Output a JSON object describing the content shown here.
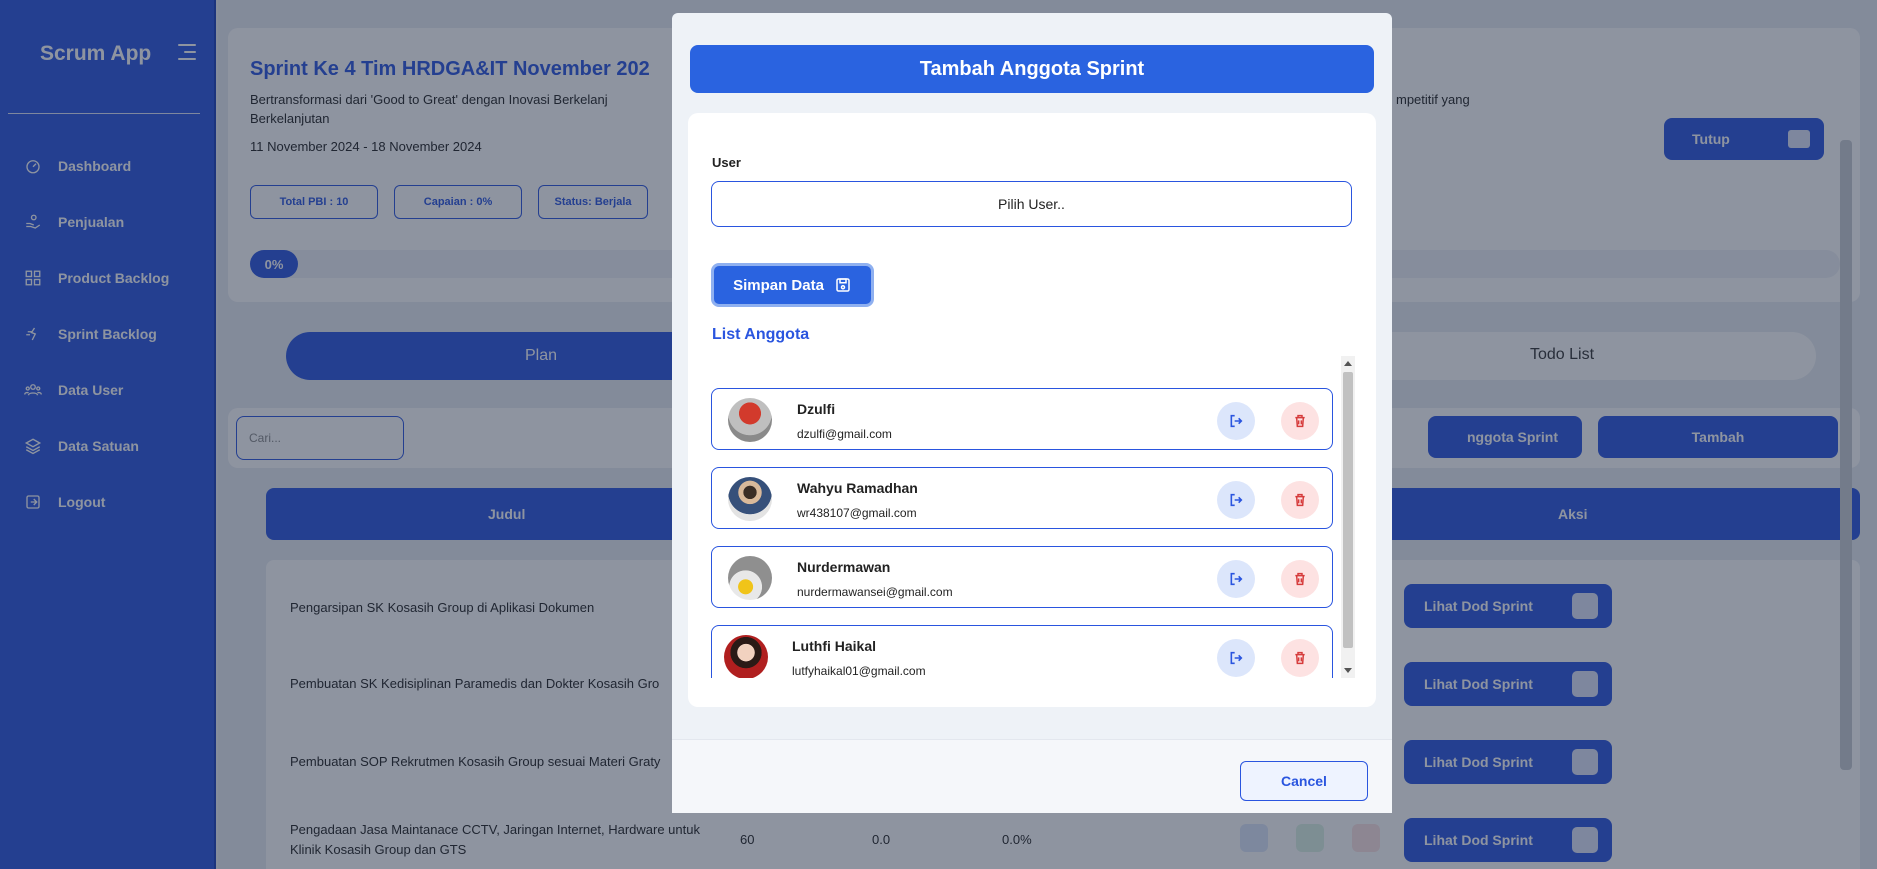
{
  "sidebar": {
    "brand": "Scrum App",
    "items": [
      {
        "label": "Dashboard",
        "icon": "dashboard-icon"
      },
      {
        "label": "Penjualan",
        "icon": "hand-coin-icon"
      },
      {
        "label": "Product Backlog",
        "icon": "grid-icon"
      },
      {
        "label": "Sprint Backlog",
        "icon": "sprint-icon"
      },
      {
        "label": "Data User",
        "icon": "users-icon"
      },
      {
        "label": "Data Satuan",
        "icon": "layers-icon"
      },
      {
        "label": "Logout",
        "icon": "logout-icon"
      }
    ]
  },
  "page": {
    "sprint_title": "Sprint Ke 4 Tim HRDGA&IT November 202",
    "description_left": "Bertransformasi dari 'Good to Great' dengan Inovasi Berkelanj",
    "description_right": "mpetitif yang",
    "description_line2": "Berkelanjutan",
    "date_range": "11 November 2024 - 18 November 2024",
    "pills": [
      "Total PBI : 10",
      "Capaian : 0%",
      "Status: Berjala"
    ],
    "progress_label": "0%",
    "close_button": "Tutup",
    "tabs": [
      "Plan",
      "Todo List"
    ],
    "search_placeholder": "Cari...",
    "btn_anggota": "nggota Sprint",
    "btn_tambah": "Tambah",
    "columns": [
      "Judul",
      "Aksi"
    ],
    "rows": [
      {
        "title": "Pengarsipan SK Kosasih Group di Aplikasi Dokumen",
        "action": "Lihat Dod Sprint"
      },
      {
        "title": "Pembuatan SK Kedisiplinan Paramedis dan Dokter Kosasih Gro",
        "action": "Lihat Dod Sprint"
      },
      {
        "title": "Pembuatan SOP Rekrutmen Kosasih Group sesuai Materi Graty",
        "action": "Lihat Dod Sprint"
      },
      {
        "title": "Pengadaan Jasa Maintanace CCTV, Jaringan Internet, Hardware untuk",
        "title2": "Klinik Kosasih Group dan GTS",
        "col2": "60",
        "col3": "0.0",
        "col4": "0.0%",
        "action": "Lihat Dod Sprint"
      }
    ]
  },
  "modal": {
    "title": "Tambah Anggota Sprint",
    "user_label": "User",
    "user_select": "Pilih User..",
    "save_button": "Simpan Data",
    "list_title": "List Anggota",
    "members": [
      {
        "name": "Dzulfi",
        "email": "dzulfi@gmail.com"
      },
      {
        "name": "Wahyu Ramadhan",
        "email": "wr438107@gmail.com"
      },
      {
        "name": "Nurdermawan",
        "email": "nurdermawansei@gmail.com"
      },
      {
        "name": "Luthfi Haikal",
        "email": "lutfyhaikal01@gmail.com"
      }
    ],
    "cancel_button": "Cancel"
  }
}
